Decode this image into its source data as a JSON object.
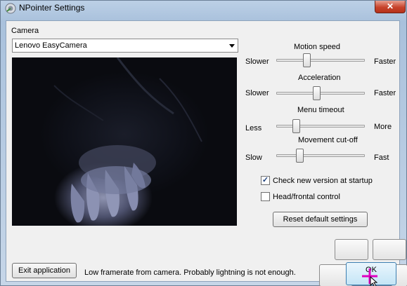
{
  "window": {
    "title": "NPointer Settings",
    "close_glyph": "✕",
    "app_icon": "npointer-icon"
  },
  "camera": {
    "label": "Camera",
    "selected": "Lenovo EasyCamera"
  },
  "sliders": [
    {
      "title": "Motion speed",
      "left_label": "Slower",
      "right_label": "Faster",
      "value": 0.33
    },
    {
      "title": "Acceleration",
      "left_label": "Slower",
      "right_label": "Faster",
      "value": 0.45
    },
    {
      "title": "Menu timeout",
      "left_label": "Less",
      "right_label": "More",
      "value": 0.2
    },
    {
      "title": "Movement cut-off",
      "left_label": "Slow",
      "right_label": "Fast",
      "value": 0.24
    }
  ],
  "checkboxes": [
    {
      "label": "Check new version at startup",
      "checked": true
    },
    {
      "label": "Head/frontal control",
      "checked": false
    }
  ],
  "buttons": {
    "reset": "Reset default settings",
    "exit": "Exit application",
    "ok": "OK"
  },
  "status": "Low framerate from camera. Probably lightning is not enough.",
  "colors": {
    "accent": "#3c7fb1",
    "close": "#c7432b",
    "cursor": "#e000c0"
  }
}
